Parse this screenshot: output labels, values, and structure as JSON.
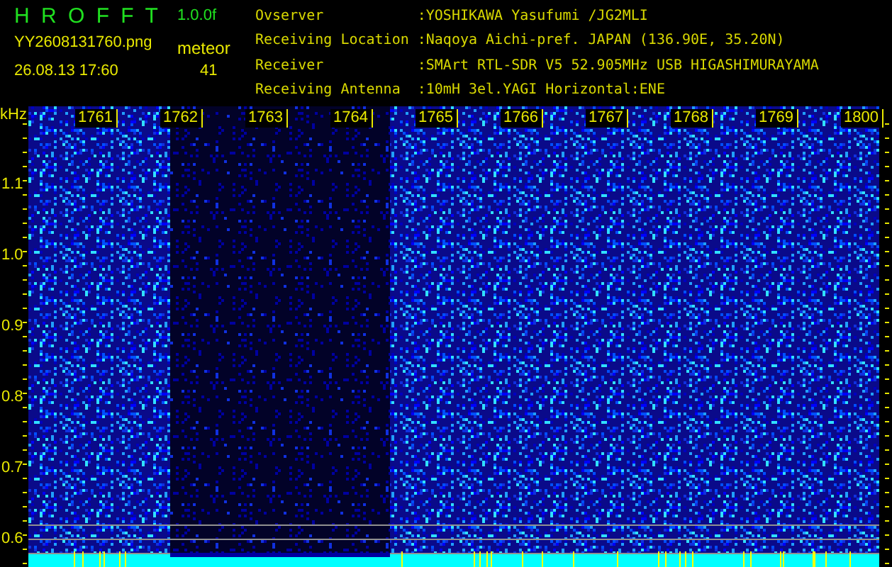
{
  "header": {
    "title": "H R O F F T",
    "version": "1.0.0f",
    "file_name": "YY2608131760.png",
    "timestamp": "26.08.13 17:60",
    "meteor_label": "meteor",
    "meteor_count": "41",
    "info": [
      {
        "label": "Ovserver",
        "value": ":YOSHIKAWA Yasufumi /JG2MLI"
      },
      {
        "label": "Receiving Location",
        "value": ":Naqoya Aichi-pref. JAPAN (136.90E, 35.20N)"
      },
      {
        "label": "Receiver",
        "value": ":SMArt RTL-SDR V5 52.905MHz USB HIGASHIMURAYAMA"
      },
      {
        "label": "Receiving Antenna",
        "value": ":10mH 3el.YAGI Horizontal:ENE"
      }
    ]
  },
  "spectrogram": {
    "unit": "kHz",
    "y_labels": [
      "1.1",
      "1.0",
      "0.9",
      "0.8",
      "0.7",
      "0.6"
    ],
    "time_labels": [
      "1761",
      "1762",
      "1763",
      "1764",
      "1765",
      "1766",
      "1767",
      "1768",
      "1769",
      "1800"
    ]
  }
}
